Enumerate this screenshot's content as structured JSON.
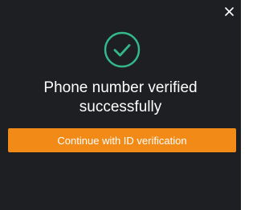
{
  "dialog": {
    "close_icon": "close-icon",
    "status_icon": "check-circle-icon",
    "title_line1": "Phone number verified",
    "title_line2": "successfully",
    "continue_label": "Continue with ID verification"
  },
  "colors": {
    "background": "#1e1f22",
    "success": "#33b88a",
    "accent": "#f28a17",
    "text": "#ffffff"
  }
}
